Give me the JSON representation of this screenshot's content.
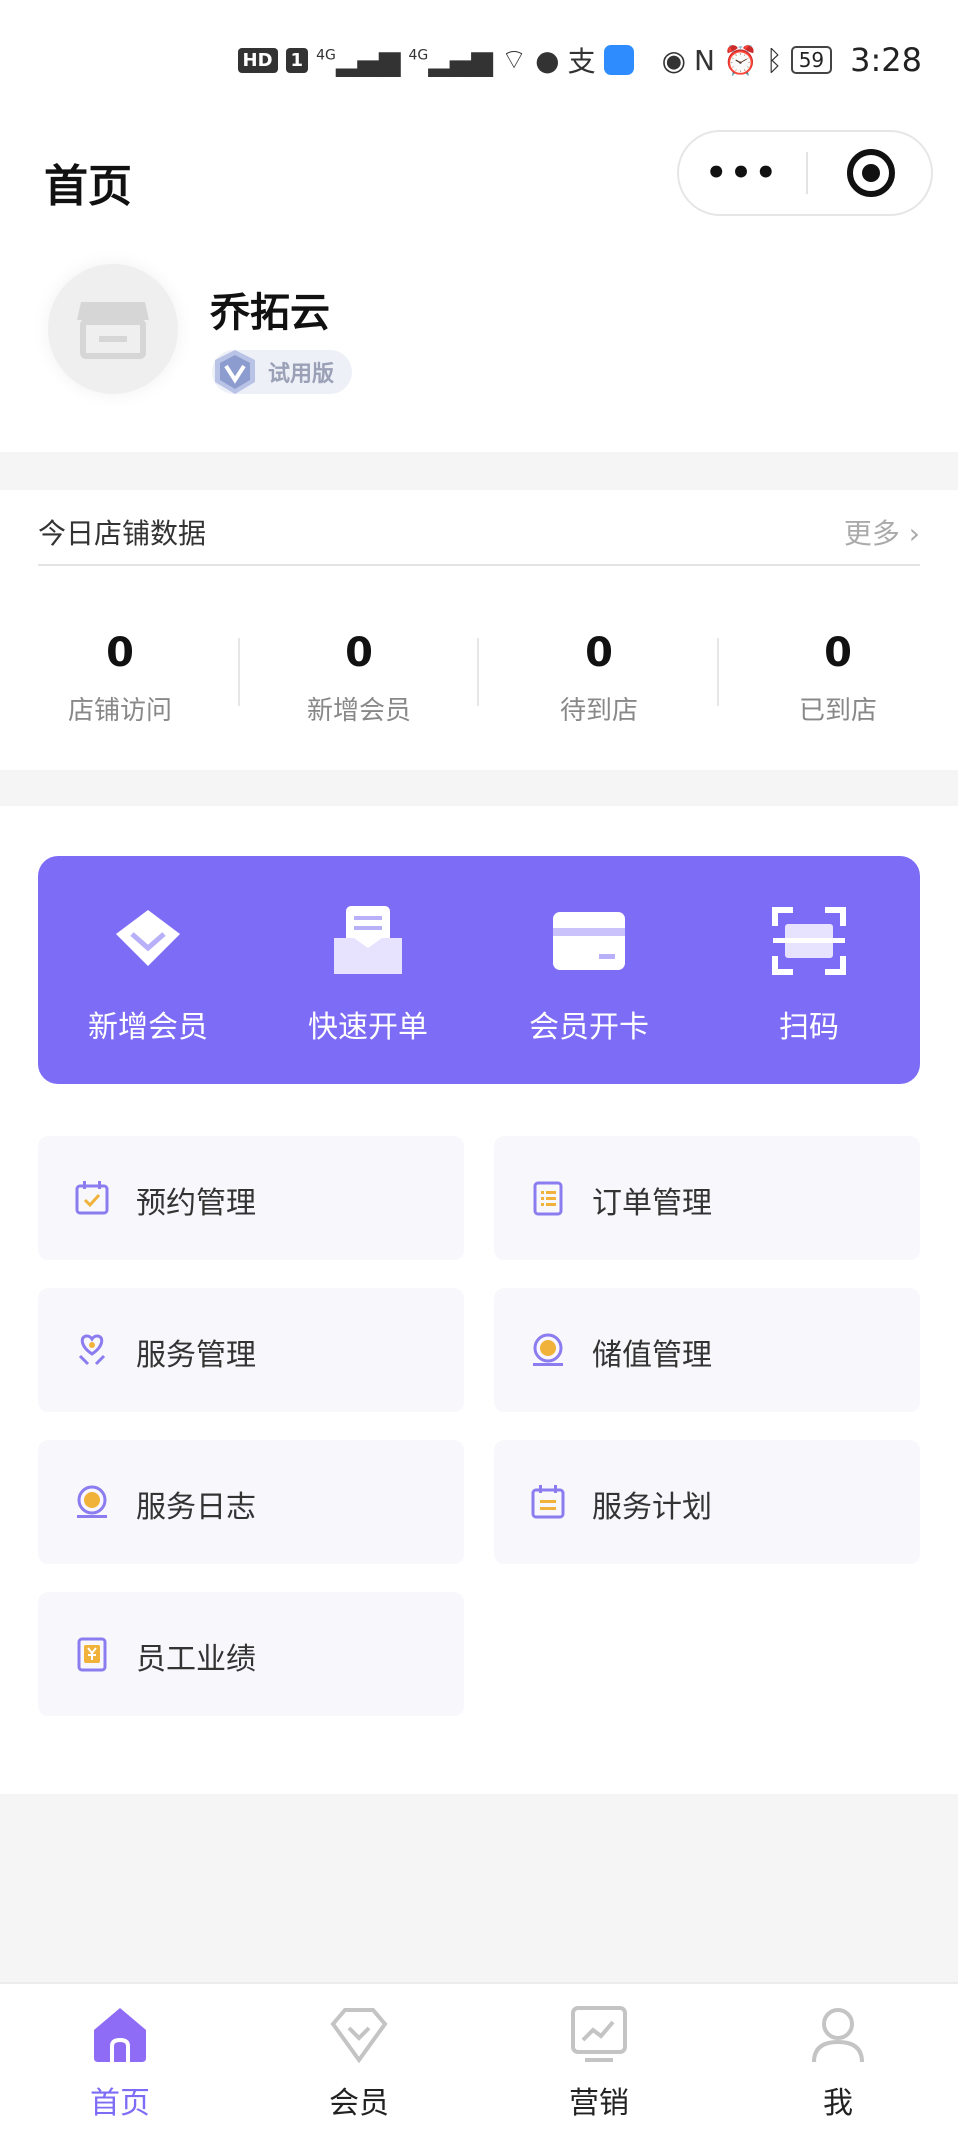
{
  "status_bar": {
    "hd": "HD",
    "sim": "1",
    "network1": "4G",
    "network2": "4G",
    "battery": "59",
    "time": "3:28"
  },
  "nav": {
    "title": "首页",
    "more": "•••"
  },
  "store": {
    "name": "乔拓云",
    "badge": "试用版"
  },
  "stats": {
    "title": "今日店铺数据",
    "more": "更多 ›",
    "items": [
      {
        "value": "0",
        "label": "店铺访问"
      },
      {
        "value": "0",
        "label": "新增会员"
      },
      {
        "value": "0",
        "label": "待到店"
      },
      {
        "value": "0",
        "label": "已到店"
      }
    ]
  },
  "quick_actions": [
    {
      "label": "新增会员",
      "icon": "diamond-icon"
    },
    {
      "label": "快速开单",
      "icon": "receipt-icon"
    },
    {
      "label": "会员开卡",
      "icon": "card-icon"
    },
    {
      "label": "扫码",
      "icon": "scan-icon"
    }
  ],
  "menu": [
    {
      "label": "预约管理",
      "icon": "calendar-check-icon"
    },
    {
      "label": "订单管理",
      "icon": "clipboard-list-icon"
    },
    {
      "label": "服务管理",
      "icon": "heart-hand-icon"
    },
    {
      "label": "储值管理",
      "icon": "coin-icon"
    },
    {
      "label": "服务日志",
      "icon": "coin-log-icon"
    },
    {
      "label": "服务计划",
      "icon": "calendar-list-icon"
    },
    {
      "label": "员工业绩",
      "icon": "yen-doc-icon"
    }
  ],
  "tabbar": {
    "active": 0,
    "items": [
      {
        "label": "首页",
        "icon": "home-icon"
      },
      {
        "label": "会员",
        "icon": "diamond-outline-icon"
      },
      {
        "label": "营销",
        "icon": "chart-screen-icon"
      },
      {
        "label": "我",
        "icon": "user-icon"
      }
    ]
  },
  "colors": {
    "accent": "#7d6cf6",
    "page_bg": "#f5f5f6",
    "menu_bg": "#f8f8fc"
  }
}
